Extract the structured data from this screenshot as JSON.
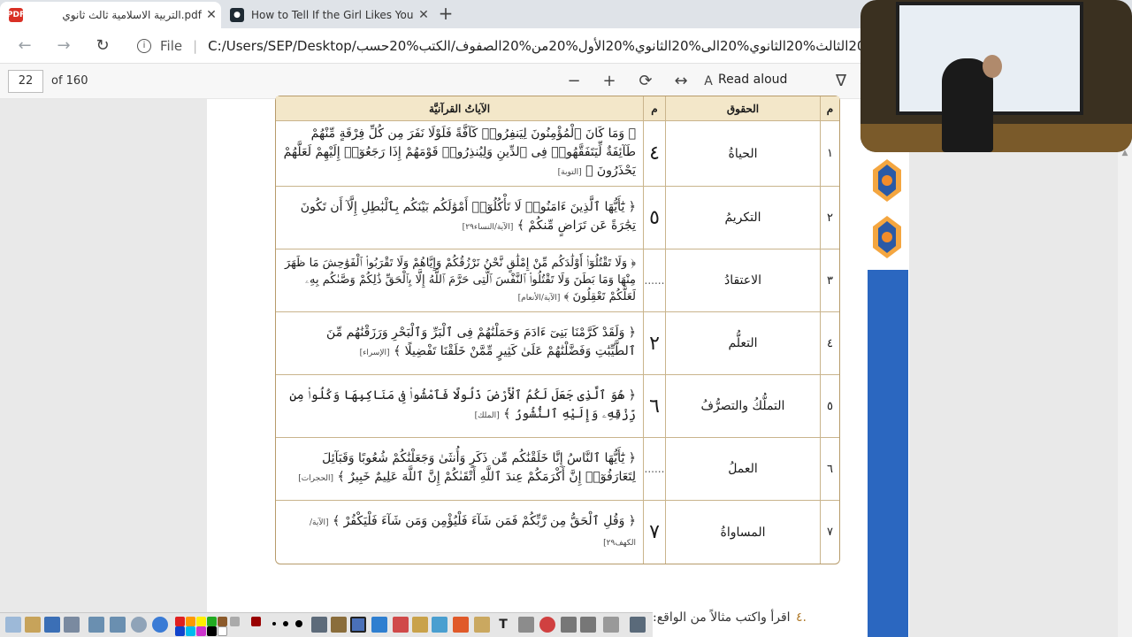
{
  "browser": {
    "tabs": [
      {
        "title": "pdf.التربية الاسلامية ثالث ثانوي",
        "icon": "pdf-icon",
        "active": true
      },
      {
        "title": "How to Tell If the Girl Likes You",
        "icon": "site-icon",
        "active": false
      }
    ],
    "address": {
      "scheme_label": "File",
      "url": "C:/Users/SEP/Desktop/ال...%20الثالث%20الثانوي%20الى%20الثانوي%20الأول%20من%20الصفوف/الكتب%20حسب"
    }
  },
  "pdf_toolbar": {
    "page_number": "22",
    "page_of": "of 160",
    "read_aloud": "Read aloud"
  },
  "table": {
    "headers": {
      "num": "م",
      "right": "الحقوق",
      "mark": "م",
      "ayah": "الآياتُ القرآنيَّة"
    },
    "rows": [
      {
        "num": "١",
        "right": "الحياةُ",
        "mark": "٤",
        "ayah": "﴿ وَمَا كَانَ ٱلْمُؤْمِنُونَ لِيَنفِرُوا۟ كَآفَّةً فَلَوْلَا نَفَرَ مِن كُلِّ فِرْقَةٍ مِّنْهُمْ طَآئِفَةٌ لِّيَتَفَقَّهُوا۟ فِى ٱلدِّينِ وَلِيُنذِرُوا۟ قَوْمَهُمْ إِذَا رَجَعُوٓا۟ إِلَيْهِمْ لَعَلَّهُمْ يَحْذَرُونَ ﴾",
        "ref": "[التوبة]"
      },
      {
        "num": "٢",
        "right": "التكريمُ",
        "mark": "٥",
        "ayah": "﴿ يَٰٓأَيُّهَا ٱلَّذِينَ ءَامَنُوا۟ لَا تَأْكُلُوٓا۟ أَمْوَٰلَكُم بَيْنَكُم بِٱلْبَٰطِلِ إِلَّآ أَن تَكُونَ تِجَٰرَةً عَن تَرَاضٍ مِّنكُمْ ﴾",
        "ref": "[الآية/النساء٢٩]"
      },
      {
        "num": "٣",
        "right": "الاعتقادُ",
        "mark": "......",
        "ayah": "﴿ وَلَا تَقْتُلُوٓا۟ أَوْلَٰدَكُم مِّنْ إِمْلَٰقٍ نَّحْنُ نَرْزُقُكُمْ وَإِيَّاهُمْ وَلَا تَقْرَبُوا۟ ٱلْفَوَٰحِشَ مَا ظَهَرَ مِنْهَا وَمَا بَطَنَ وَلَا تَقْتُلُوا۟ ٱلنَّفْسَ ٱلَّتِى حَرَّمَ ٱللَّهُ إِلَّا بِٱلْحَقِّ ذَٰلِكُمْ وَصَّىٰكُم بِهِۦ لَعَلَّكُمْ تَعْقِلُونَ ﴾",
        "ref": "[الآية/الأنعام]"
      },
      {
        "num": "٤",
        "right": "التعلُّم",
        "mark": "٢",
        "ayah": "﴿ وَلَقَدْ كَرَّمْنَا بَنِىٓ ءَادَمَ وَحَمَلْنَٰهُمْ فِى ٱلْبَرِّ وَٱلْبَحْرِ وَرَزَقْنَٰهُم مِّنَ ٱلطَّيِّبَٰتِ وَفَضَّلْنَٰهُمْ عَلَىٰ كَثِيرٍ مِّمَّنْ خَلَقْنَا تَفْضِيلًا ﴾",
        "ref": "[الإسراء]"
      },
      {
        "num": "٥",
        "right": "التملُّكُ والتصرُّفُ",
        "mark": "٦",
        "ayah": "﴿ هُوَ ٱلَّذِى جَعَلَ لَكُمُ ٱلْأَرْضَ ذَلُولًا فَٱمْشُوا۟ فِى مَنَاكِبِهَا وَكُلُوا۟ مِن رِّزْقِهِۦ وَإِلَيْهِ ٱلنُّشُورُ ﴾",
        "ref": "[الملك]"
      },
      {
        "num": "٦",
        "right": "العملُ",
        "mark": "......",
        "ayah": "﴿ يَٰٓأَيُّهَا ٱلنَّاسُ إِنَّا خَلَقْنَٰكُم مِّن ذَكَرٍ وَأُنثَىٰ وَجَعَلْنَٰكُمْ شُعُوبًا وَقَبَآئِلَ لِتَعَارَفُوٓا۟ إِنَّ أَكْرَمَكُمْ عِندَ ٱللَّهِ أَتْقَىٰكُمْ إِنَّ ٱللَّهَ عَلِيمٌ خَبِيرٌ ﴾",
        "ref": "[الحجرات]"
      },
      {
        "num": "٧",
        "right": "المساواةُ",
        "mark": "٧",
        "ayah": "﴿ وَقُلِ ٱلْحَقُّ مِن رَّبِّكُمْ فَمَن شَآءَ فَلْيُؤْمِن وَمَن شَآءَ فَلْيَكْفُرْ ﴾",
        "ref": "[الآية/الكهف٢٩]"
      }
    ]
  },
  "bottom": {
    "number": "٤.",
    "text": "اقرأ واكتب مثالاً من الواقع:"
  },
  "colors": {
    "accent_ink": "#1c2bd6",
    "table_border": "#b79b6b",
    "table_header": "#f3e7c9",
    "side_blue": "#2b67c0"
  }
}
